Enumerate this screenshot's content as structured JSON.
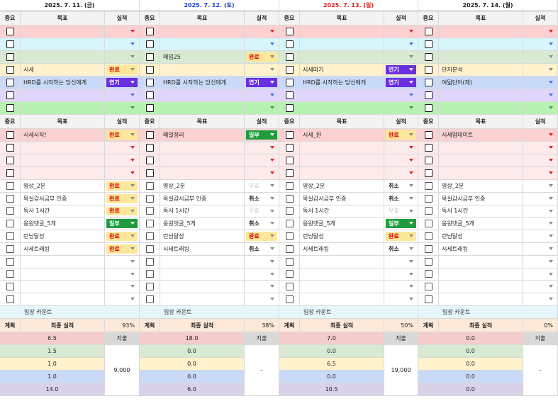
{
  "days": [
    {
      "date": "2025. 7. 11. (금)",
      "color": "#222"
    },
    {
      "date": "2025. 7. 12. (토)",
      "color": "#1a3ec8"
    },
    {
      "date": "2025. 7. 13. (일)",
      "color": "#d42020"
    },
    {
      "date": "2025. 7. 14. (월)",
      "color": "#222"
    }
  ],
  "headers": {
    "importance": "중요",
    "goal": "목표",
    "result": "실적"
  },
  "dropdown_options_visible": [
    "완료",
    "연기",
    "일부",
    "취소",
    "무효"
  ],
  "section1": [
    {
      "bg": "#fbd1d1",
      "dd": "red",
      "cells": [
        {
          "goal": "",
          "result": ""
        },
        {
          "goal": "",
          "result": ""
        },
        {
          "goal": "",
          "result": ""
        },
        {
          "goal": "",
          "result": ""
        }
      ]
    },
    {
      "bg": "#d7f6fb",
      "dd": "blue",
      "cells": [
        {
          "goal": "",
          "result": ""
        },
        {
          "goal": "",
          "result": ""
        },
        {
          "goal": "",
          "result": ""
        },
        {
          "goal": "",
          "result": ""
        }
      ]
    },
    {
      "bg": "#d9ead3",
      "dd": "gray",
      "cells": [
        {
          "goal": "",
          "result": ""
        },
        {
          "goal": "매임25",
          "result": "완료"
        },
        {
          "goal": "",
          "result": ""
        },
        {
          "goal": "",
          "result": ""
        }
      ]
    },
    {
      "bg": "#fff2cc",
      "dd": "gray",
      "cells": [
        {
          "goal": "시세",
          "result": "완료"
        },
        {
          "goal": "",
          "result": ""
        },
        {
          "goal": "시세따기",
          "result": "연기"
        },
        {
          "goal": "단지분석",
          "result": ""
        }
      ]
    },
    {
      "bg": "#c9daf8",
      "dd": "blue",
      "cells": [
        {
          "goal": "HRD를 시작하는 당신에게",
          "result": "연기"
        },
        {
          "goal": "HRD를 시작하는 당신에게",
          "result": "연기"
        },
        {
          "goal": "HRD를 시작하는 당신에게",
          "result": "연기"
        },
        {
          "goal": "여덟단어(재)",
          "result": ""
        }
      ]
    },
    {
      "bg": "#e1d5fb",
      "dd": "blue",
      "cells": [
        {
          "goal": "",
          "result": ""
        },
        {
          "goal": "",
          "result": ""
        },
        {
          "goal": "",
          "result": ""
        },
        {
          "goal": "",
          "result": ""
        }
      ]
    },
    {
      "bg": "#b7f2b2",
      "dd": "green",
      "cells": [
        {
          "goal": "",
          "result": ""
        },
        {
          "goal": "",
          "result": ""
        },
        {
          "goal": "",
          "result": ""
        },
        {
          "goal": "",
          "result": ""
        }
      ]
    }
  ],
  "section2": [
    {
      "bg": "#fbd1d1",
      "cells": [
        {
          "goal": "시세시작!",
          "result": "완료"
        },
        {
          "goal": "매일정리",
          "result": "일부"
        },
        {
          "goal": "시세_완",
          "result": "완료"
        },
        {
          "goal": "시세업데이트",
          "result": ""
        }
      ]
    },
    {
      "bg": "#fdeaea",
      "cells": [
        {
          "goal": "",
          "result": ""
        },
        {
          "goal": "",
          "result": ""
        },
        {
          "goal": "",
          "result": ""
        },
        {
          "goal": "",
          "result": ""
        }
      ]
    },
    {
      "bg": "#fdeaea",
      "cells": [
        {
          "goal": "",
          "result": ""
        },
        {
          "goal": "",
          "result": ""
        },
        {
          "goal": "",
          "result": ""
        },
        {
          "goal": "",
          "result": ""
        }
      ]
    },
    {
      "bg": "#fdeaea",
      "cells": [
        {
          "goal": "",
          "result": ""
        },
        {
          "goal": "",
          "result": ""
        },
        {
          "goal": "",
          "result": ""
        },
        {
          "goal": "",
          "result": ""
        }
      ]
    }
  ],
  "section3": [
    {
      "cells": [
        {
          "goal": "명상_2분",
          "result": "완료"
        },
        {
          "goal": "명상_2분",
          "result": "무효"
        },
        {
          "goal": "명상_2분",
          "result": "취소"
        },
        {
          "goal": "명상_2분",
          "result": ""
        }
      ]
    },
    {
      "cells": [
        {
          "goal": "목실감시금부 인증",
          "result": "완료"
        },
        {
          "goal": "목실감시금부 인증",
          "result": "취소"
        },
        {
          "goal": "목실감시금부 인증",
          "result": "취소"
        },
        {
          "goal": "목실감시금부 인증",
          "result": ""
        }
      ]
    },
    {
      "cells": [
        {
          "goal": "독서 1시간",
          "result": "완료"
        },
        {
          "goal": "독서 1시간",
          "result": "무효"
        },
        {
          "goal": "독서 1시간",
          "result": "무효"
        },
        {
          "goal": "독서 1시간",
          "result": ""
        }
      ]
    },
    {
      "cells": [
        {
          "goal": "응원댓글_5개",
          "result": "일부"
        },
        {
          "goal": "응원댓글_5개",
          "result": "취소"
        },
        {
          "goal": "응원댓글_5개",
          "result": "일부"
        },
        {
          "goal": "응원댓글_5개",
          "result": ""
        }
      ]
    },
    {
      "cells": [
        {
          "goal": "런닝달성",
          "result": "완료"
        },
        {
          "goal": "런닝달성",
          "result": "완료"
        },
        {
          "goal": "런닝달성",
          "result": "완료"
        },
        {
          "goal": "런닝달성",
          "result": ""
        }
      ]
    },
    {
      "cells": [
        {
          "goal": "시세트래킹",
          "result": "완료"
        },
        {
          "goal": "시세트래킹",
          "result": "취소"
        },
        {
          "goal": "시세트래킹",
          "result": "취소"
        },
        {
          "goal": "시세트래킹",
          "result": ""
        }
      ]
    },
    {
      "cells": [
        {
          "goal": "",
          "result": ""
        },
        {
          "goal": "",
          "result": ""
        },
        {
          "goal": "",
          "result": ""
        },
        {
          "goal": "",
          "result": ""
        }
      ]
    },
    {
      "cells": [
        {
          "goal": "",
          "result": ""
        },
        {
          "goal": "",
          "result": ""
        },
        {
          "goal": "",
          "result": ""
        },
        {
          "goal": "",
          "result": ""
        }
      ]
    },
    {
      "cells": [
        {
          "goal": "",
          "result": ""
        },
        {
          "goal": "",
          "result": ""
        },
        {
          "goal": "",
          "result": ""
        },
        {
          "goal": "",
          "result": ""
        }
      ]
    },
    {
      "cells": [
        {
          "goal": "",
          "result": ""
        },
        {
          "goal": "",
          "result": ""
        },
        {
          "goal": "",
          "result": ""
        },
        {
          "goal": "",
          "result": ""
        }
      ]
    }
  ],
  "count_label": "임장 카운트",
  "summary": {
    "plan": "계획",
    "final": "최종 실적",
    "pct": [
      "93%",
      "38%",
      "50%",
      "0%"
    ]
  },
  "expense_label": "지출",
  "plan_rows": [
    {
      "bg": "#f4cccc",
      "vals": [
        "6.5",
        "18.0",
        "7.0",
        "0.0"
      ]
    },
    {
      "bg": "#d9ead3",
      "vals": [
        "1.5",
        "0.0",
        "0.0",
        "0.0"
      ]
    },
    {
      "bg": "#fff2cc",
      "vals": [
        "1.0",
        "0.0",
        "6.5",
        "0.0"
      ]
    },
    {
      "bg": "#c9daf8",
      "vals": [
        "1.0",
        "0.0",
        "0.0",
        "0.0"
      ]
    },
    {
      "bg": "#d9d2e9",
      "vals": [
        "14.0",
        "6.0",
        "10.5",
        "0.0"
      ]
    }
  ],
  "expenses": [
    "9,000",
    "–",
    "19,000",
    "–"
  ]
}
